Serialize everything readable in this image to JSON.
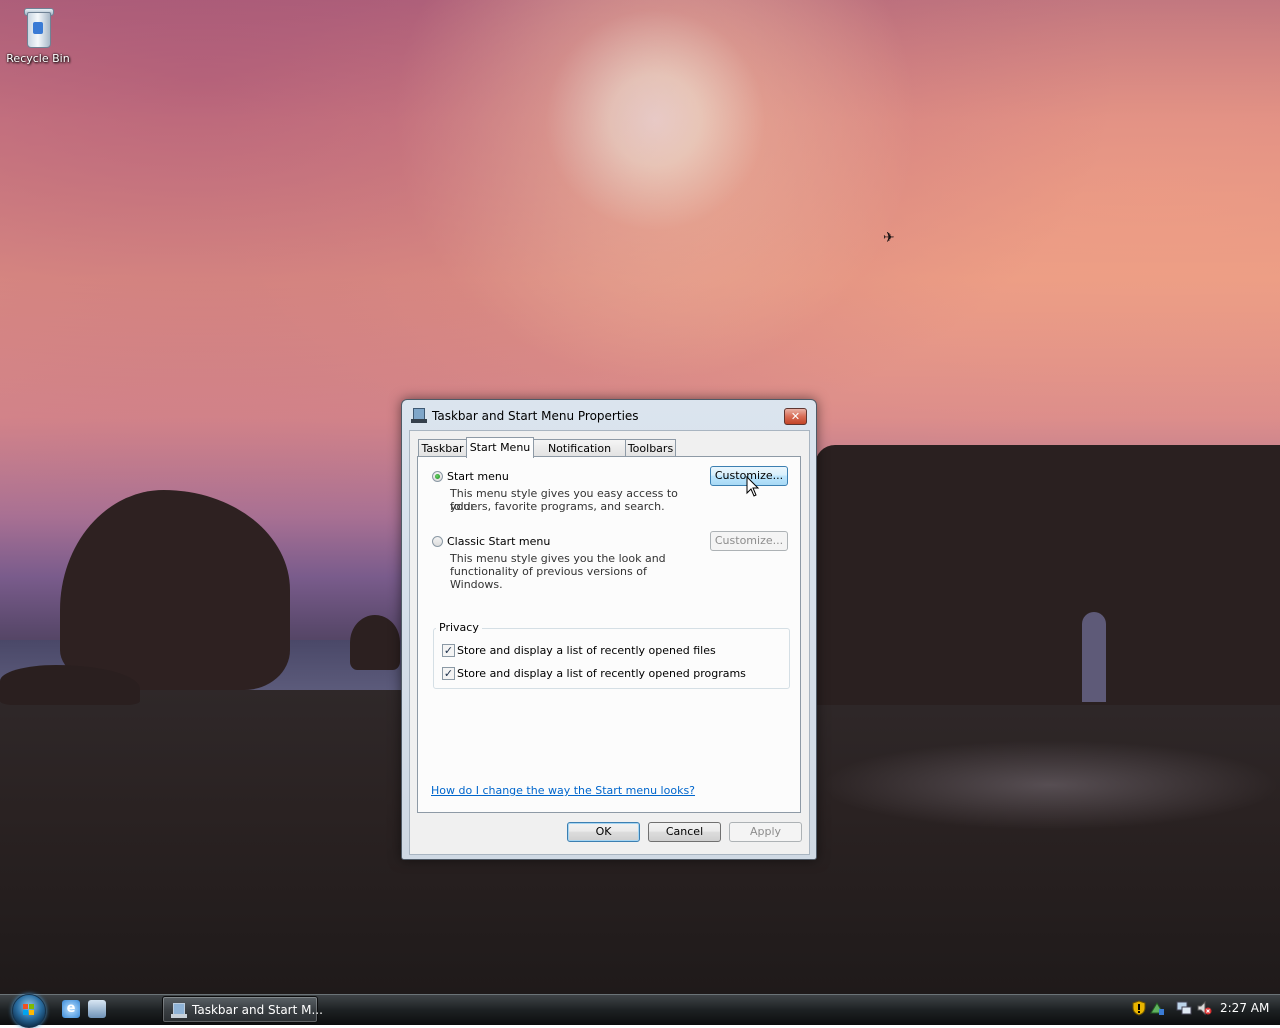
{
  "desktop": {
    "icons": [
      {
        "label": "Recycle Bin",
        "icon": "recycle-bin-icon"
      }
    ]
  },
  "dialog": {
    "title": "Taskbar and Start Menu Properties",
    "close_symbol": "✕",
    "tabs": [
      {
        "label": "Taskbar",
        "active": false
      },
      {
        "label": "Start Menu",
        "active": true
      },
      {
        "label": "Notification Area",
        "active": false
      },
      {
        "label": "Toolbars",
        "active": false
      }
    ],
    "start_menu": {
      "label": "Start menu",
      "selected": true,
      "description_line1": "This menu style gives you easy access to your",
      "description_line2": "folders, favorite programs, and search.",
      "customize_label": "Customize..."
    },
    "classic_menu": {
      "label": "Classic Start menu",
      "selected": false,
      "description_line1": "This menu style gives you the look and",
      "description_line2": "functionality of previous versions of Windows.",
      "customize_label": "Customize..."
    },
    "privacy": {
      "title": "Privacy",
      "items": [
        {
          "label": "Store and display a list of recently opened files",
          "checked": true
        },
        {
          "label": "Store and display a list of recently opened programs",
          "checked": true
        }
      ]
    },
    "help_link": "How do I change the way the Start menu looks?",
    "buttons": {
      "ok": "OK",
      "cancel": "Cancel",
      "apply": "Apply"
    }
  },
  "taskbar": {
    "start_icon": "windows-orb-icon",
    "quicklaunch": [
      "internet-explorer-icon",
      "switch-windows-icon"
    ],
    "quicklaunch_ie_glyph": "e",
    "window_button": "Taskbar and Start M...",
    "tray_icons": [
      "security-shield-icon",
      "network-icon",
      "network-connection-icon",
      "volume-muted-icon"
    ],
    "clock": "2:27 AM"
  },
  "colors": {
    "link": "#0066cc",
    "hot_button_border": "#3c7fb1",
    "close_button": "#c24528"
  }
}
